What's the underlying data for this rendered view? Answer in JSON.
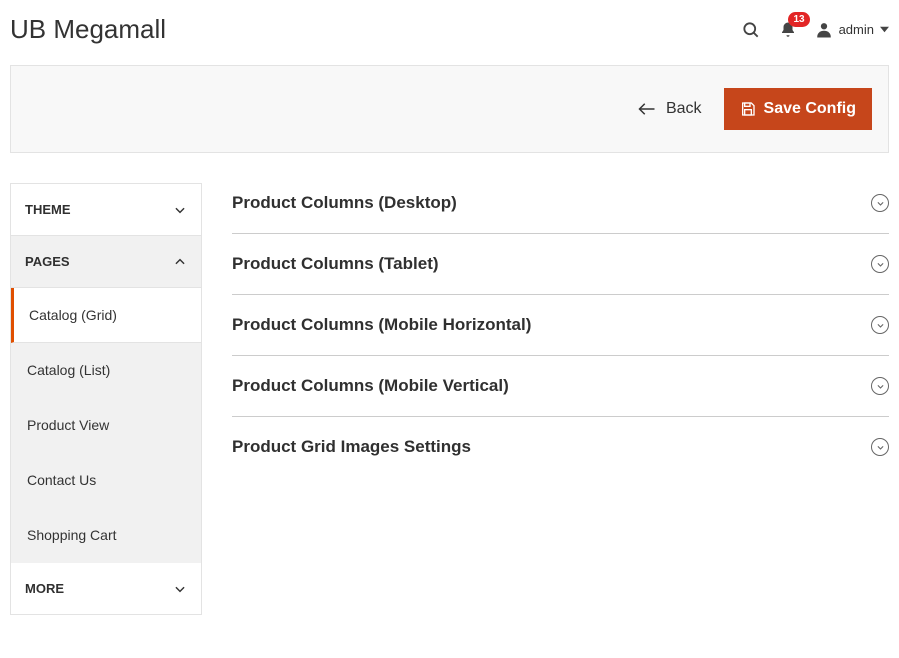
{
  "header": {
    "title": "UB Megamall",
    "notifications": "13",
    "user": "admin"
  },
  "actions": {
    "back": "Back",
    "save": "Save Config"
  },
  "sidebar": {
    "panels": [
      {
        "label": "THEME",
        "expanded": false
      },
      {
        "label": "PAGES",
        "expanded": true
      },
      {
        "label": "MORE",
        "expanded": false
      }
    ],
    "pages_items": [
      "Catalog (Grid)",
      "Catalog (List)",
      "Product View",
      "Contact Us",
      "Shopping Cart"
    ]
  },
  "sections": [
    "Product Columns (Desktop)",
    "Product Columns (Tablet)",
    "Product Columns (Mobile Horizontal)",
    "Product Columns (Mobile Vertical)",
    "Product Grid Images Settings"
  ]
}
